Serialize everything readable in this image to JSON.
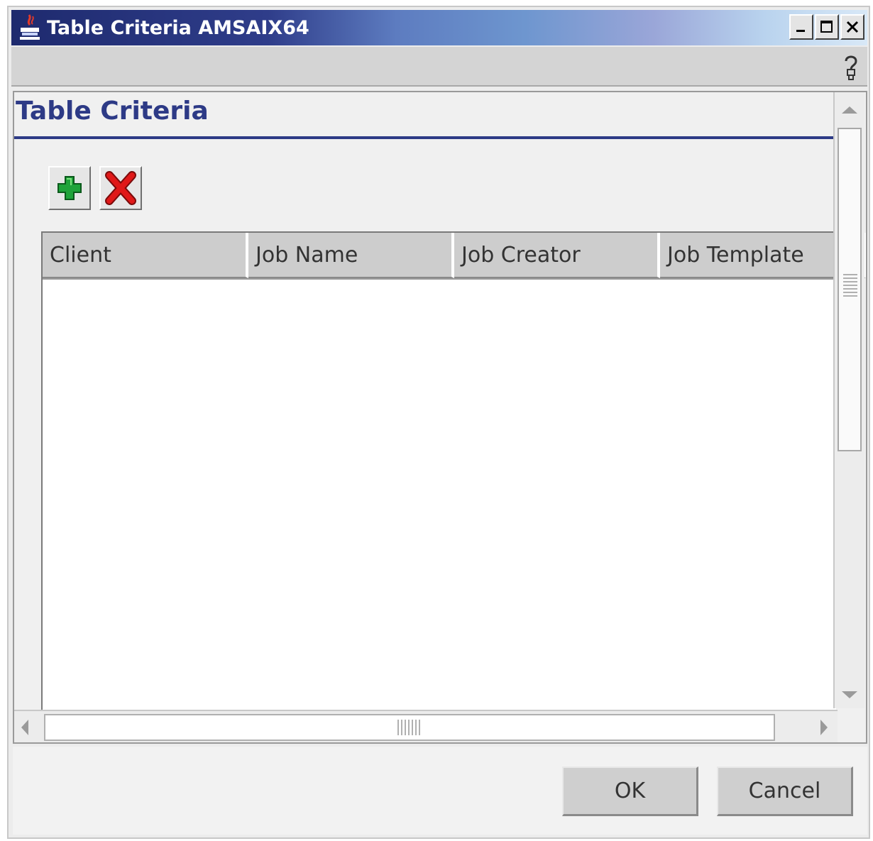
{
  "window": {
    "title": "Table Criteria AMSAIX64",
    "icon": "java-cup-icon"
  },
  "help": {
    "icon": "help-icon"
  },
  "section": {
    "title": "Table Criteria"
  },
  "toolbar": {
    "add": {
      "icon": "green-plus-icon",
      "color": "#1fa33a"
    },
    "delete": {
      "icon": "red-x-icon",
      "color": "#e01818"
    }
  },
  "table": {
    "columns": [
      "Client",
      "Job Name",
      "Job Creator",
      "Job Template"
    ],
    "rows": []
  },
  "buttons": {
    "ok": "OK",
    "cancel": "Cancel"
  },
  "colors": {
    "accent": "#2d3a86",
    "titlebar_start": "#1e2a6e",
    "titlebar_end": "#d8e8f7"
  }
}
